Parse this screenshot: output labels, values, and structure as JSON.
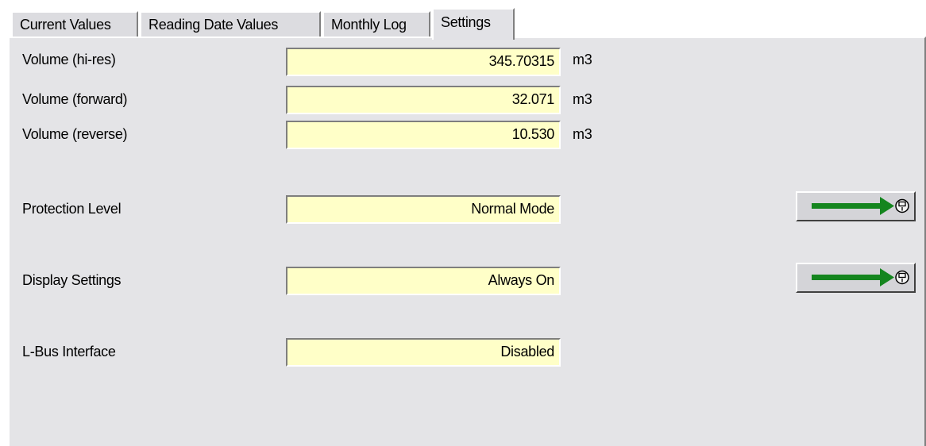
{
  "tabs": [
    {
      "label": "Current Values",
      "active": false
    },
    {
      "label": "Reading Date Values",
      "active": false
    },
    {
      "label": "Monthly Log",
      "active": false
    },
    {
      "label": "Settings",
      "active": true
    }
  ],
  "rows": {
    "volume_hires": {
      "label": "Volume (hi-res)",
      "value": "345.70315",
      "unit": "m3"
    },
    "volume_forward": {
      "label": "Volume (forward)",
      "value": "32.071",
      "unit": "m3"
    },
    "volume_reverse": {
      "label": "Volume (reverse)",
      "value": "10.530",
      "unit": "m3"
    },
    "protection_level": {
      "label": "Protection Level",
      "value": "Normal Mode"
    },
    "display_settings": {
      "label": "Display Settings",
      "value": "Always On"
    },
    "lbus_interface": {
      "label": "L-Bus Interface",
      "value": "Disabled"
    }
  },
  "colors": {
    "field_bg": "#ffffc8",
    "panel_bg": "#e4e4e7",
    "arrow": "#14851e"
  },
  "icons": {
    "apply_button": "green-arrow-to-meter-icon"
  }
}
